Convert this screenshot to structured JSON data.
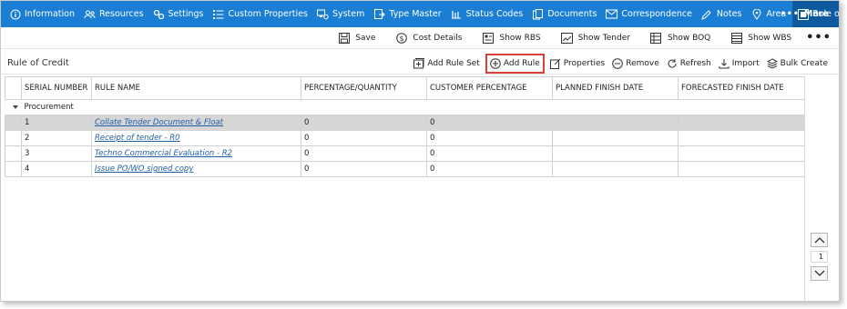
{
  "nav": {
    "items": [
      {
        "label": "Information",
        "icon": "info-icon"
      },
      {
        "label": "Resources",
        "icon": "people-icon"
      },
      {
        "label": "Settings",
        "icon": "settings-icon"
      },
      {
        "label": "Custom Properties",
        "icon": "list-icon"
      },
      {
        "label": "System",
        "icon": "system-icon"
      },
      {
        "label": "Type Master",
        "icon": "type-master-icon"
      },
      {
        "label": "Status Codes",
        "icon": "status-codes-icon"
      },
      {
        "label": "Documents",
        "icon": "documents-icon"
      },
      {
        "label": "Correspondence",
        "icon": "envelope-icon"
      },
      {
        "label": "Notes",
        "icon": "pencil-icon"
      },
      {
        "label": "Area",
        "icon": "map-pin-icon"
      },
      {
        "label": "Rule of Credit",
        "icon": "rule-icon",
        "active": true
      }
    ],
    "more_label": "More",
    "color": "#1a7fd4",
    "active_color": "#0d5a9e"
  },
  "toolbar": {
    "save_label": "Save",
    "cost_details_label": "Cost Details",
    "show_rbs_label": "Show RBS",
    "show_tender_label": "Show Tender",
    "show_boq_label": "Show BOQ",
    "show_wbs_label": "Show WBS"
  },
  "section": {
    "title": "Rule of Credit",
    "actions": {
      "add_rule_set": "Add Rule Set",
      "add_rule": "Add Rule",
      "properties": "Properties",
      "remove": "Remove",
      "refresh": "Refresh",
      "import": "Import",
      "bulk_create": "Bulk Create"
    },
    "highlight_color": "#d8403c"
  },
  "grid": {
    "columns": [
      "SERIAL NUMBER",
      "RULE NAME",
      "PERCENTAGE/QUANTITY",
      "CUSTOMER PERCENTAGE",
      "PLANNED FINISH DATE",
      "FORECASTED FINISH DATE"
    ],
    "group": "Procurement",
    "rows": [
      {
        "serial": "1",
        "name": "Collate Tender Document & Float",
        "percentage": "0",
        "customer": "0",
        "planned": "",
        "forecast": ""
      },
      {
        "serial": "2",
        "name": "Receipt of tender - R0",
        "percentage": "0",
        "customer": "0",
        "planned": "",
        "forecast": ""
      },
      {
        "serial": "3",
        "name": "Techno Commercial Evaluation - R2",
        "percentage": "0",
        "customer": "0",
        "planned": "",
        "forecast": ""
      },
      {
        "serial": "4",
        "name": "Issue PO/WO signed copy",
        "percentage": "0",
        "customer": "0",
        "planned": "",
        "forecast": ""
      }
    ]
  },
  "pager": {
    "page": "1"
  }
}
